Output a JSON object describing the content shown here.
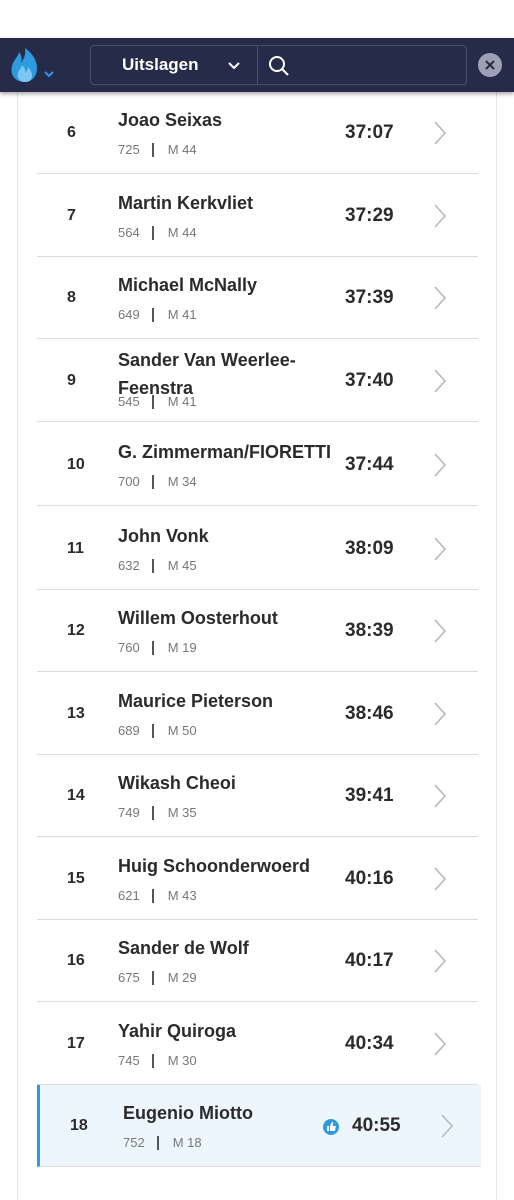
{
  "header": {
    "section_select": "Uitslagen",
    "search_placeholder": "",
    "icons": [
      "flame-logo-icon",
      "chevron-down-icon",
      "search-icon",
      "close-icon"
    ],
    "accent_color": "#2e9bdf",
    "bar_color": "#262b4a"
  },
  "results": [
    {
      "rank": "6",
      "name": "Joao Seixas",
      "bib": "725",
      "category": "M 44",
      "time": "37:07"
    },
    {
      "rank": "7",
      "name": "Martin Kerkvliet",
      "bib": "564",
      "category": "M 44",
      "time": "37:29"
    },
    {
      "rank": "8",
      "name": "Michael McNally",
      "bib": "649",
      "category": "M 41",
      "time": "37:39"
    },
    {
      "rank": "9",
      "name": "Sander Van Weerlee-Feenstra",
      "bib": "545",
      "category": "M 41",
      "time": "37:40"
    },
    {
      "rank": "10",
      "name": "G. Zimmerman/FIORETTI",
      "bib": "700",
      "category": "M 34",
      "time": "37:44"
    },
    {
      "rank": "11",
      "name": "John Vonk",
      "bib": "632",
      "category": "M 45",
      "time": "38:09"
    },
    {
      "rank": "12",
      "name": "Willem Oosterhout",
      "bib": "760",
      "category": "M 19",
      "time": "38:39"
    },
    {
      "rank": "13",
      "name": "Maurice Pieterson",
      "bib": "689",
      "category": "M 50",
      "time": "38:46"
    },
    {
      "rank": "14",
      "name": "Wikash Cheoi",
      "bib": "749",
      "category": "M 35",
      "time": "39:41"
    },
    {
      "rank": "15",
      "name": "Huig Schoonderwoerd",
      "bib": "621",
      "category": "M 43",
      "time": "40:16"
    },
    {
      "rank": "16",
      "name": "Sander de Wolf",
      "bib": "675",
      "category": "M 29",
      "time": "40:17"
    },
    {
      "rank": "17",
      "name": "Yahir Quiroga",
      "bib": "745",
      "category": "M 30",
      "time": "40:34"
    },
    {
      "rank": "18",
      "name": "Eugenio Miotto",
      "bib": "752",
      "category": "M 18",
      "time": "40:55",
      "highlighted": true
    }
  ]
}
